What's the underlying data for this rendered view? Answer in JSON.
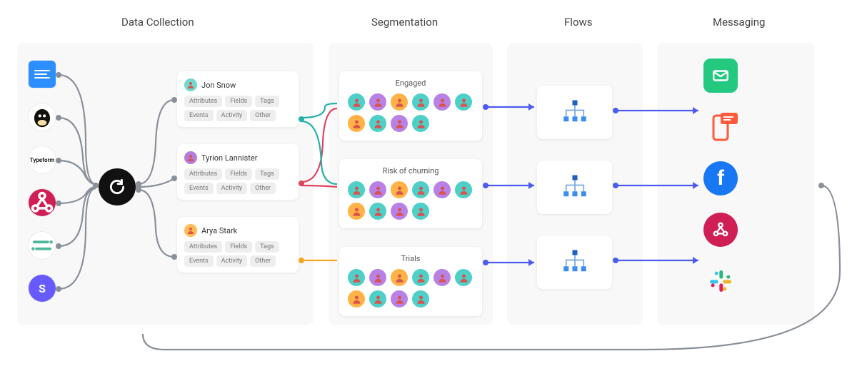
{
  "stages": {
    "data_collection": "Data Collection",
    "segmentation": "Segmentation",
    "flows": "Flows",
    "messaging": "Messaging"
  },
  "sources": [
    {
      "id": "doc",
      "label": "Document"
    },
    {
      "id": "mailchimp",
      "label": "Mailchimp"
    },
    {
      "id": "typeform",
      "label": "Typeform"
    },
    {
      "id": "webhook",
      "label": "Webhook"
    },
    {
      "id": "segment",
      "label": "Segment"
    },
    {
      "id": "stripe",
      "label": "Stripe",
      "glyph": "S"
    }
  ],
  "hub": {
    "label": "Encharge hub"
  },
  "profiles": [
    {
      "name": "Jon Snow",
      "avatar_color": "teal",
      "chips": [
        "Attributes",
        "Fields",
        "Tags",
        "Events",
        "Activity",
        "Other"
      ]
    },
    {
      "name": "Tyrion Lannister",
      "avatar_color": "purple",
      "chips": [
        "Attributes",
        "Fields",
        "Tags",
        "Events",
        "Activity",
        "Other"
      ]
    },
    {
      "name": "Arya Stark",
      "avatar_color": "orange",
      "chips": [
        "Attributes",
        "Fields",
        "Tags",
        "Events",
        "Activity",
        "Other"
      ]
    }
  ],
  "segments": [
    {
      "title": "Engaged",
      "avatars": [
        "teal",
        "purple",
        "orange",
        "teal",
        "purple",
        "teal",
        "orange",
        "teal",
        "purple",
        "teal"
      ]
    },
    {
      "title": "Risk of churning",
      "avatars": [
        "teal",
        "purple",
        "orange",
        "teal",
        "purple",
        "teal",
        "orange",
        "teal",
        "purple",
        "teal"
      ]
    },
    {
      "title": "Trials",
      "avatars": [
        "teal",
        "purple",
        "orange",
        "teal",
        "purple",
        "teal",
        "orange",
        "teal",
        "purple",
        "teal"
      ]
    }
  ],
  "flows_count": 3,
  "channels": [
    {
      "id": "email",
      "label": "Email"
    },
    {
      "id": "sms",
      "label": "SMS / Push"
    },
    {
      "id": "facebook",
      "label": "Facebook",
      "glyph": "f"
    },
    {
      "id": "webhook",
      "label": "Webhook"
    },
    {
      "id": "slack",
      "label": "Slack"
    }
  ],
  "colors": {
    "gray": "#8a9099",
    "red": "#e0435d",
    "teal": "#25b1a7",
    "orange": "#f5a623",
    "blue": "#4c5bf0"
  }
}
